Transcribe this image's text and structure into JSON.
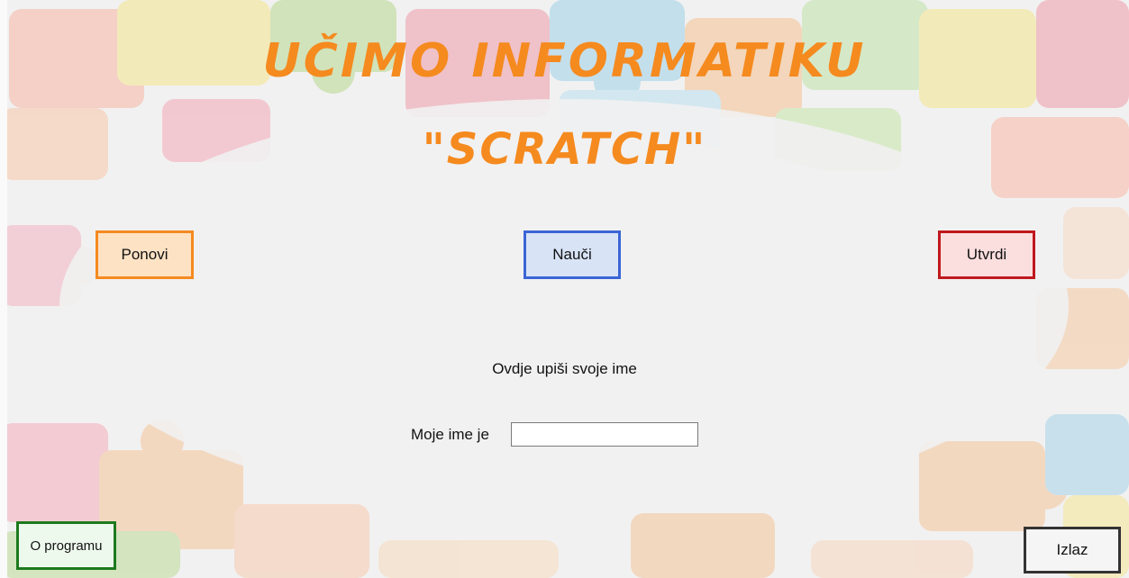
{
  "header": {
    "title_line1": "UČIMO  INFORMATIKU",
    "title_line2": "\"SCRATCH\""
  },
  "nav": {
    "ponovi_label": "Ponovi",
    "nauci_label": "Nauči",
    "utvrdi_label": "Utvrdi"
  },
  "form": {
    "hint": "Ovdje upiši svoje ime",
    "name_label": "Moje ime je",
    "name_value": "",
    "name_placeholder": ""
  },
  "footer": {
    "about_label": "O programu",
    "exit_label": "Izlaz"
  },
  "colors": {
    "title": "#f58a1f",
    "ponovi_border": "#f58a1f",
    "nauci_border": "#3b65d6",
    "utvrdi_border": "#c0181d",
    "about_border": "#1e7a1e",
    "exit_border": "#333333"
  },
  "background": {
    "icon": "puzzle-pieces-pattern"
  }
}
